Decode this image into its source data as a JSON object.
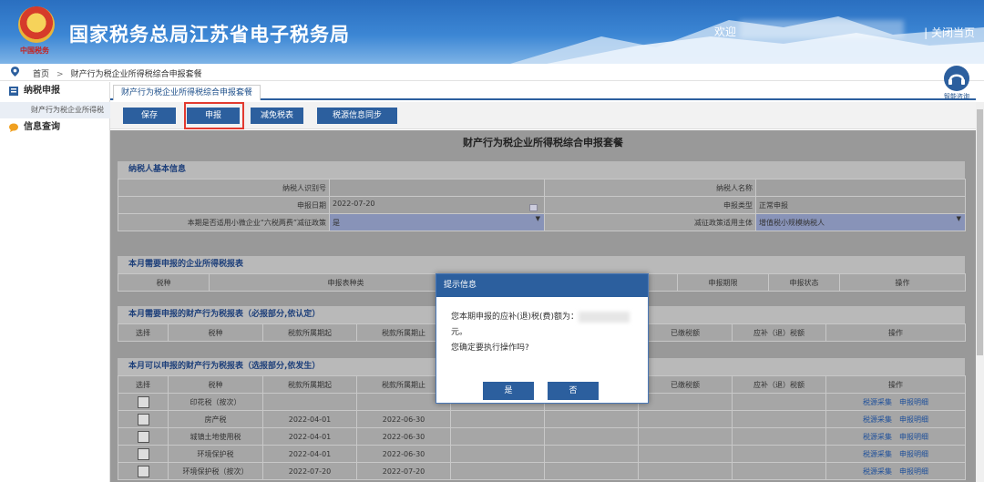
{
  "header": {
    "title": "国家税务总局江苏省电子税务局",
    "emblem_sub": "中国税务",
    "welcome": "欢迎",
    "close_label": "| 关闭当页"
  },
  "breadcrumb": {
    "home": "首页",
    "sep": ">",
    "current": "财产行为税企业所得税综合申报套餐"
  },
  "sidebar": {
    "items": [
      {
        "label": "纳税申报"
      },
      {
        "label": "财产行为税企业所得税"
      },
      {
        "label": "信息查询"
      }
    ]
  },
  "tab": {
    "label": "财产行为税企业所得税综合申报套餐"
  },
  "toolbar": {
    "save": "保存",
    "declare": "申报",
    "reduce": "减免税表",
    "sync": "税源信息同步"
  },
  "assist": {
    "label": "智能咨询"
  },
  "page_title": "财产行为税企业所得税综合申报套餐",
  "basic": {
    "section_title": "纳税人基本信息",
    "taxpayer_id_label": "纳税人识别号",
    "taxpayer_name_label": "纳税人名称",
    "date_label": "申报日期",
    "date_value": "2022-07-20",
    "type_label": "申报类型",
    "type_value": "正常申报",
    "policy_label": "本期是否适用小微企业“六税两费”减征政策",
    "policy_value": "是",
    "subject_label": "减征政策适用主体",
    "subject_value": "增值税小规模纳税人"
  },
  "sec1": {
    "title": "本月需要申报的企业所得税报表",
    "headers": [
      "税种",
      "申报表种类",
      "",
      "申报期限",
      "申报状态",
      "操作"
    ]
  },
  "sec2": {
    "title": "本月需要申报的财产行为税报表（必报部分,依认定）",
    "headers": [
      "选择",
      "税种",
      "税款所属期起",
      "税款所属期止",
      "",
      "",
      "已缴税额",
      "应补（退）税额",
      "操作"
    ]
  },
  "sec3": {
    "title": "本月可以申报的财产行为税报表（选报部分,依发生）",
    "headers": [
      "选择",
      "税种",
      "税款所属期起",
      "税款所属期止",
      "",
      "",
      "已缴税额",
      "应补（退）税额",
      "操作"
    ],
    "rows": [
      {
        "tax": "印花税（按次）",
        "start": "",
        "end": ""
      },
      {
        "tax": "房产税",
        "start": "2022-04-01",
        "end": "2022-06-30"
      },
      {
        "tax": "城镇土地使用税",
        "start": "2022-04-01",
        "end": "2022-06-30"
      },
      {
        "tax": "环境保护税",
        "start": "2022-04-01",
        "end": "2022-06-30"
      },
      {
        "tax": "环境保护税（按次）",
        "start": "2022-07-20",
        "end": "2022-07-20"
      }
    ],
    "link_collect": "税源采集",
    "link_detail": "申报明细"
  },
  "dialog": {
    "title": "提示信息",
    "line1": "您本期申报的应补(退)税(费)额为：",
    "line2": "元。",
    "line3": "您确定要执行操作吗?",
    "yes": "是",
    "no": "否"
  }
}
